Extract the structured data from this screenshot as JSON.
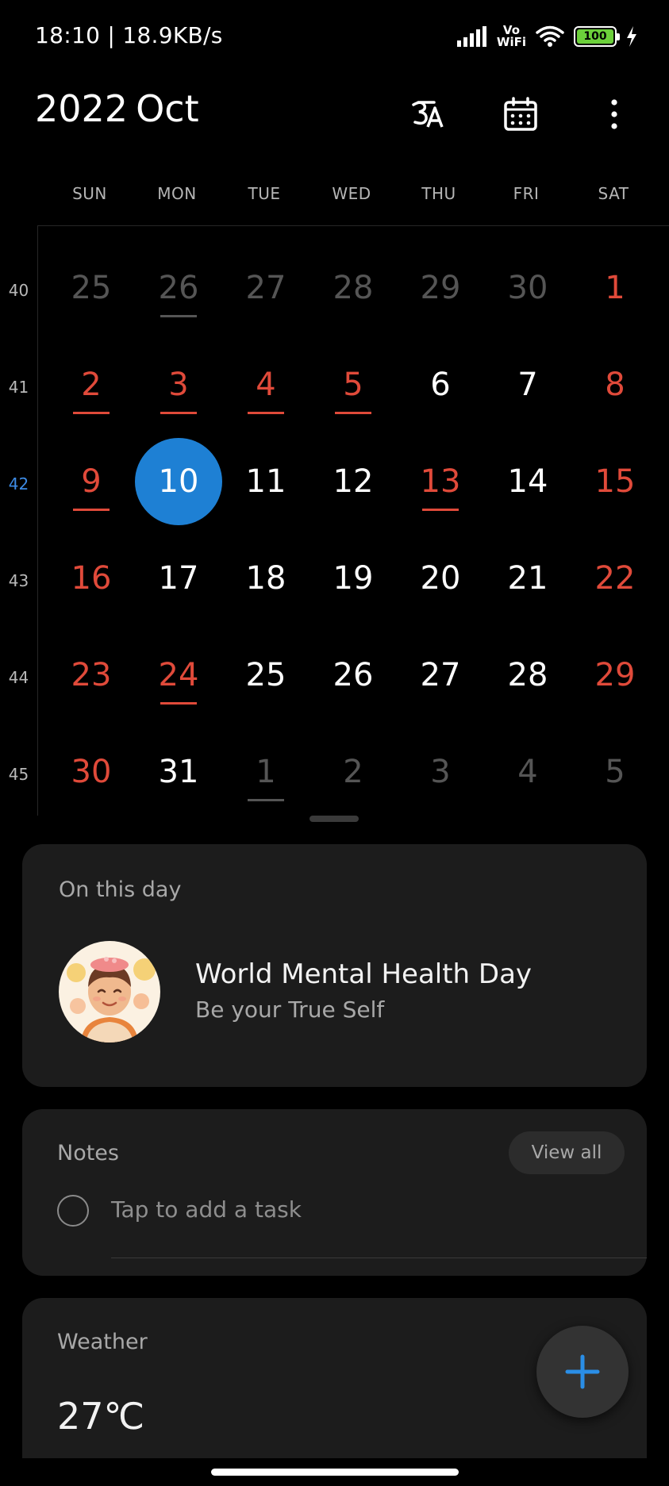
{
  "status_bar": {
    "time_speed": "18:10 | 18.9KB/s",
    "vowifi_line1": "Vo",
    "vowifi_line2": "WiFi",
    "battery": "100"
  },
  "header": {
    "year": "2022",
    "month": "Oct",
    "lang_icon": "hindi-language-icon",
    "calendar_icon": "calendar-icon",
    "more_icon": "more-vertical-icon"
  },
  "weekdays": [
    "SUN",
    "MON",
    "TUE",
    "WED",
    "THU",
    "FRI",
    "SAT"
  ],
  "weeks": [
    {
      "num": "40",
      "days": [
        {
          "d": "25",
          "other": true
        },
        {
          "d": "26",
          "other": true,
          "underline": true
        },
        {
          "d": "27",
          "other": true
        },
        {
          "d": "28",
          "other": true
        },
        {
          "d": "29",
          "other": true
        },
        {
          "d": "30",
          "other": true
        },
        {
          "d": "1",
          "red": true
        }
      ]
    },
    {
      "num": "41",
      "days": [
        {
          "d": "2",
          "red": true,
          "underline": true
        },
        {
          "d": "3",
          "red": true,
          "underline": true
        },
        {
          "d": "4",
          "red": true,
          "underline": true
        },
        {
          "d": "5",
          "red": true,
          "underline": true
        },
        {
          "d": "6"
        },
        {
          "d": "7"
        },
        {
          "d": "8",
          "red": true
        }
      ]
    },
    {
      "num": "42",
      "current": true,
      "days": [
        {
          "d": "9",
          "red": true,
          "underline": true
        },
        {
          "d": "10",
          "today": true
        },
        {
          "d": "11"
        },
        {
          "d": "12"
        },
        {
          "d": "13",
          "red": true,
          "underline": true
        },
        {
          "d": "14"
        },
        {
          "d": "15",
          "red": true
        }
      ]
    },
    {
      "num": "43",
      "days": [
        {
          "d": "16",
          "red": true
        },
        {
          "d": "17"
        },
        {
          "d": "18"
        },
        {
          "d": "19"
        },
        {
          "d": "20"
        },
        {
          "d": "21"
        },
        {
          "d": "22",
          "red": true
        }
      ]
    },
    {
      "num": "44",
      "days": [
        {
          "d": "23",
          "red": true
        },
        {
          "d": "24",
          "red": true,
          "underline": true
        },
        {
          "d": "25"
        },
        {
          "d": "26"
        },
        {
          "d": "27"
        },
        {
          "d": "28"
        },
        {
          "d": "29",
          "red": true
        }
      ]
    },
    {
      "num": "45",
      "days": [
        {
          "d": "30",
          "red": true
        },
        {
          "d": "31"
        },
        {
          "d": "1",
          "other": true,
          "underline": true
        },
        {
          "d": "2",
          "other": true
        },
        {
          "d": "3",
          "other": true
        },
        {
          "d": "4",
          "other": true
        },
        {
          "d": "5",
          "other": true
        }
      ]
    }
  ],
  "on_this_day": {
    "label": "On this day",
    "title": "World Mental Health Day",
    "subtitle": "Be your True Self"
  },
  "notes": {
    "label": "Notes",
    "view_all": "View all",
    "placeholder": "Tap to add a task"
  },
  "weather": {
    "label": "Weather",
    "temperature": "27℃"
  },
  "fab_icon": "plus-icon",
  "colors": {
    "holiday_red": "#e04a3a",
    "today_blue": "#1e80d4",
    "current_week_blue": "#3d8be5",
    "card_bg": "#1c1c1c"
  }
}
